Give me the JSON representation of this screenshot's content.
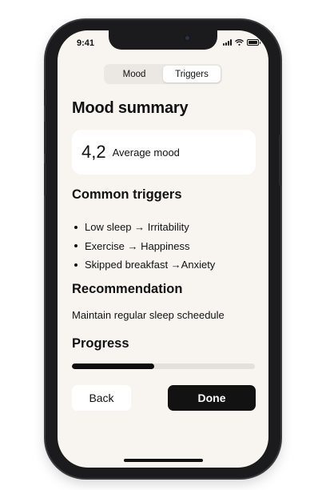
{
  "status_bar": {
    "time": "9:41"
  },
  "tabs": [
    {
      "label": "Mood",
      "active": false
    },
    {
      "label": "Triggers",
      "active": true
    }
  ],
  "summary": {
    "title": "Mood summary",
    "average_value": "4,2",
    "average_label": "Average mood"
  },
  "triggers": {
    "heading": "Common triggers",
    "items": [
      "Low sleep → Irritability",
      "Exercise → Happiness",
      "Skipped breakfast →Anxiety"
    ]
  },
  "recommendation": {
    "heading": "Recommendation",
    "text": "Maintain regular sleep scheedule"
  },
  "progress": {
    "heading": "Progress",
    "fraction": 0.45
  },
  "actions": {
    "back_label": "Back",
    "done_label": "Done"
  },
  "colors": {
    "screen_background": "#f8f5f1",
    "primary_button": "#121212",
    "progress_fill": "#0d0d0d",
    "progress_track": "#e4e1dd"
  },
  "icons": [
    "signal-icon",
    "wifi-icon",
    "battery-icon"
  ]
}
